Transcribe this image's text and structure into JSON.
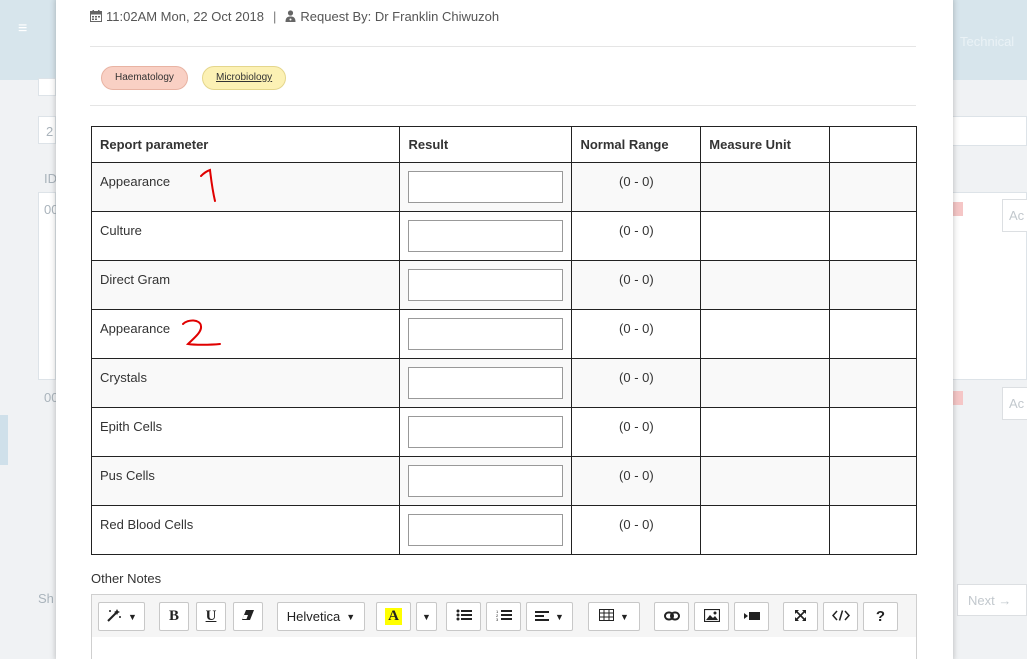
{
  "background": {
    "menu_icon": "≡",
    "user_text": "Technical",
    "field_text": "2",
    "id_text": "ID",
    "row1_text": "00",
    "row2_text": "00",
    "show_text": "Sh",
    "action1_text": "Ac",
    "action2_text": "Ac",
    "next_label": "Next →"
  },
  "modal": {
    "timestamp": "11:02AM Mon, 22 Oct 2018",
    "separator": "|",
    "request_by": "Request By: Dr Franklin Chiwuzoh",
    "tags": [
      {
        "label": "Haematology",
        "color": "#f9d0c4"
      },
      {
        "label": "Microbiology",
        "color": "#fcf1b4"
      }
    ],
    "table": {
      "headers": [
        "Report parameter",
        "Result",
        "Normal Range",
        "Measure Unit",
        ""
      ],
      "rows": [
        {
          "parameter": "Appearance",
          "result": "",
          "range": "(0 - 0)",
          "unit": "",
          "extra": ""
        },
        {
          "parameter": "Culture",
          "result": "",
          "range": "(0 - 0)",
          "unit": "",
          "extra": ""
        },
        {
          "parameter": "Direct Gram",
          "result": "",
          "range": "(0 - 0)",
          "unit": "",
          "extra": ""
        },
        {
          "parameter": "Appearance",
          "result": "",
          "range": "(0 - 0)",
          "unit": "",
          "extra": ""
        },
        {
          "parameter": "Crystals",
          "result": "",
          "range": "(0 - 0)",
          "unit": "",
          "extra": ""
        },
        {
          "parameter": "Epith Cells",
          "result": "",
          "range": "(0 - 0)",
          "unit": "",
          "extra": ""
        },
        {
          "parameter": "Pus Cells",
          "result": "",
          "range": "(0 - 0)",
          "unit": "",
          "extra": ""
        },
        {
          "parameter": "Red Blood Cells",
          "result": "",
          "range": "(0 - 0)",
          "unit": "",
          "extra": ""
        }
      ]
    },
    "other_notes_label": "Other Notes",
    "editor": {
      "font_name": "Helvetica",
      "bold": "B",
      "underline": "U",
      "highlight": "A",
      "help": "?"
    }
  },
  "annotations": {
    "mark_1": "1",
    "mark_2": "2",
    "color": "#e00000"
  },
  "icons": [
    "calendar-icon",
    "user-md-icon",
    "magic-wand-icon",
    "eraser-icon",
    "unordered-list-icon",
    "ordered-list-icon",
    "align-left-icon",
    "table-icon",
    "link-icon",
    "picture-icon",
    "video-icon",
    "fullscreen-icon",
    "code-view-icon"
  ]
}
